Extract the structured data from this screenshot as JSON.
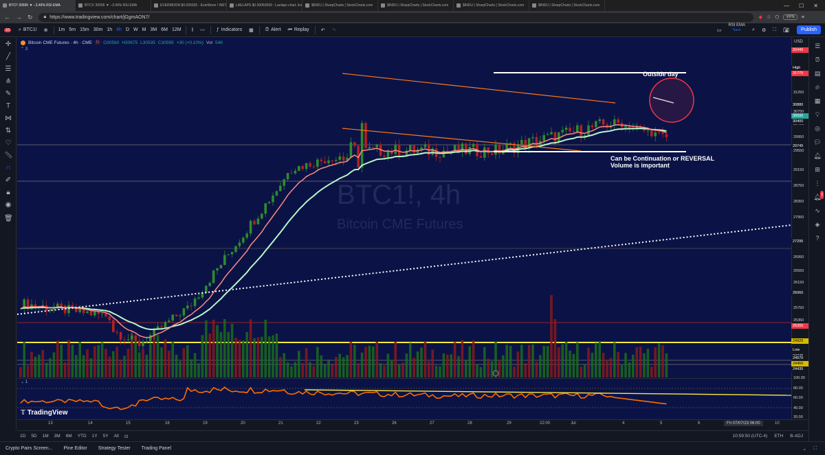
{
  "browser": {
    "tabs": [
      {
        "label": "BTC!! 30595 ▼ −3.49% RSI EMA",
        "active": true
      },
      {
        "label": "BTC1! 30595 ▼ −3.49% RSI EMA",
        "active": false
      },
      {
        "label": "EVERMOON $0.005935 - EverMoon / WETH on Eth...",
        "active": false
      },
      {
        "label": "LAELAPS $0.00060599 - Laelaps chart, live forecast",
        "active": false
      },
      {
        "label": "$INDU | SharpCharts | StockCharts.com",
        "active": false
      },
      {
        "label": "$INDU | SharpCharts | StockCharts.com",
        "active": false
      },
      {
        "label": "$INDU | SharpCharts | StockCharts.com",
        "active": false
      },
      {
        "label": "$INDU | SharpCharts | StockCharts.com",
        "active": false
      }
    ],
    "url": "https://www.tradingview.com/chart/jGgmAON7/",
    "vpn_label": "VPN"
  },
  "toolbar": {
    "badge": "10",
    "symbol": "BTC1!",
    "intervals": [
      "1m",
      "5m",
      "15m",
      "30m",
      "1h",
      "4h",
      "D",
      "W",
      "M",
      "3M",
      "6M",
      "12M"
    ],
    "selected_interval": "4h",
    "indicators_label": "Indicators",
    "alert_label": "Alert",
    "replay_label": "Replay",
    "template_name": "RSI EMA",
    "save_label": "Save",
    "publish_label": "Publish"
  },
  "legend": {
    "title": "Bitcoin CME Futures · 4h · CME",
    "open": "O30560",
    "high": "H30675",
    "low": "L30535",
    "close": "C30595",
    "change": "+30 (+0.10%)",
    "vol_label": "Vol",
    "vol": "546",
    "sub": "3",
    "badge_d": "D"
  },
  "watermark": {
    "symbol": "BTC1!, 4h",
    "name": "Bitcoin CME Futures"
  },
  "annotations": {
    "outside_day": "Outside day",
    "note_line1": "Can be Continuation or REVERSAL",
    "note_line2": "Volume is important"
  },
  "price_axis": {
    "currency": "USD",
    "labels": [
      "32250",
      "31835",
      "31250",
      "30750",
      "30400",
      "29950",
      "29550",
      "29150",
      "28750",
      "28350",
      "27950",
      "26950",
      "26550",
      "26150",
      "25750",
      "25350",
      "24920",
      "24570",
      "24435"
    ],
    "boxes": [
      {
        "v": "32445",
        "c": "#f23645"
      },
      {
        "v": "High",
        "c": "#131722"
      },
      {
        "v": "31775",
        "c": "#f23645"
      },
      {
        "v": "30880",
        "c": "#131722"
      },
      {
        "v": "30595",
        "c": "#26a69a"
      },
      {
        "v": "30400",
        "c": "#131722"
      },
      {
        "v": "29745",
        "c": "#131722"
      },
      {
        "v": "27295",
        "c": "#131722"
      },
      {
        "v": "26060",
        "c": "#131722"
      },
      {
        "v": "25300",
        "c": "#f23645"
      },
      {
        "v": "24920",
        "c": "#d6b900"
      },
      {
        "v": "Low",
        "c": "#131722"
      },
      {
        "v": "24745",
        "c": "#131722"
      },
      {
        "v": "24570",
        "c": "#131722"
      },
      {
        "v": "24460",
        "c": "#d6b900"
      },
      {
        "v": "24435",
        "c": "#131722"
      }
    ]
  },
  "rsi_axis": [
    "100.00",
    "80.00",
    "60.00",
    "40.00",
    "20.00"
  ],
  "rsi_legend": "1",
  "time_axis": [
    "13",
    "14",
    "15",
    "16",
    "19",
    "20",
    "21",
    "22",
    "23",
    "26",
    "27",
    "28",
    "29",
    "22:00",
    "Jul",
    "4",
    "5",
    "6",
    "7",
    "10"
  ],
  "time_box": "Fri 07/07/23 06:00",
  "range": {
    "buttons": [
      "1D",
      "5D",
      "1M",
      "3M",
      "6M",
      "YTD",
      "1Y",
      "5Y",
      "All"
    ],
    "clock": "10:59:50 (UTC-4)",
    "session": "ETH",
    "mode": "B-ADJ"
  },
  "bottom": {
    "tabs": [
      "Crypto Pairs Screen...",
      "Pine Editor",
      "Strategy Tester",
      "Trading Panel"
    ]
  },
  "brand": "TradingView",
  "rightbar_badge": "3",
  "colors": {
    "bg": "#0b1346",
    "up": "#2e8b2e",
    "down": "#b22222",
    "ema_fast": "#ff8a80",
    "ema_slow": "#b9f6ca",
    "rsi": "#ff6d00",
    "wedge": "#ff7a1a",
    "level": "#ffeb3b",
    "circle": "#f23645"
  },
  "chart_data": {
    "type": "candlestick",
    "price_range": [
      24200,
      32700
    ],
    "candles": []
  }
}
